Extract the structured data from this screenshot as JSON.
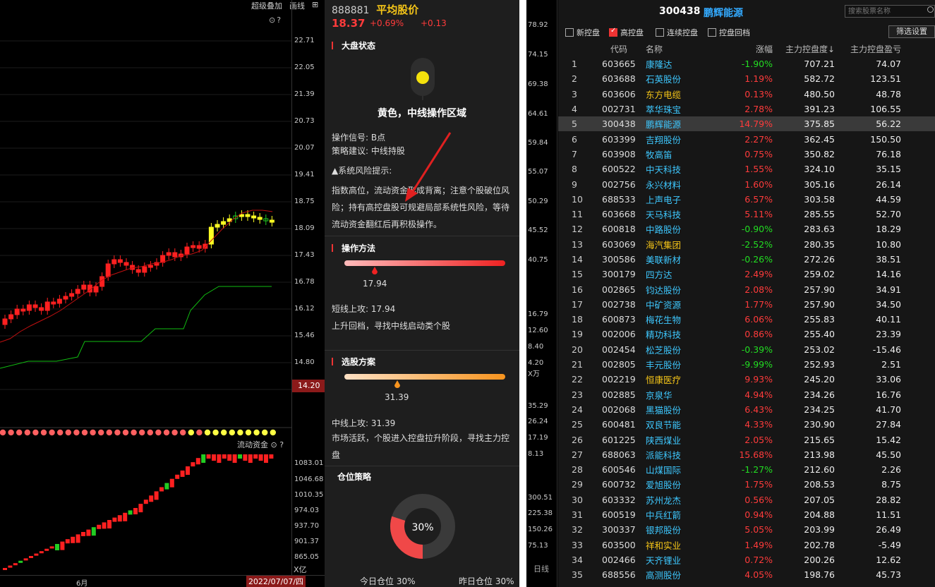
{
  "left_panel": {
    "toolbar": {
      "overlay_label": "超级叠加",
      "draw_label": "画线"
    },
    "price_axis": [
      "22.71",
      "22.05",
      "21.39",
      "20.73",
      "20.07",
      "19.41",
      "18.75",
      "18.09",
      "17.43",
      "16.78",
      "16.12",
      "15.46",
      "14.80"
    ],
    "current_price_label": "14.20",
    "fund_label": "流动资金",
    "fund_axis": [
      "1083.01",
      "1046.68",
      "1010.35",
      "974.03",
      "937.70",
      "901.37",
      "865.05"
    ],
    "fund_unit": "X亿",
    "month_label": "6月",
    "date_label": "2022/07/07/四"
  },
  "info_panel": {
    "code": "888881",
    "name": "平均股价",
    "price": "18.37",
    "change_pct": "+0.69%",
    "change": "+0.13",
    "market_state_title": "大盘状态",
    "light_color": "#f5e20c",
    "state_text": "黄色，中线操作区域",
    "signal": "操作信号: B点",
    "advice": "策略建议: 中线持股",
    "risk_title": "▲系统风险提示:",
    "risk_text": "指数高位，流动资金形成背离；注意个股破位风险；持有高控盘股可规避局部系统性风险，等待流动资金翻红后再积极操作。",
    "method_title": "操作方法",
    "method_value": "17.94",
    "method_line1": "短线上攻: 17.94",
    "method_line2": "上升回档，寻找中线启动类个股",
    "pick_title": "选股方案",
    "pick_value": "31.39",
    "pick_line1": "中线上攻: 31.39",
    "pick_text": "市场活跃，个股进入控盘拉升阶段，寻找主力控盘",
    "position_title": "仓位策略",
    "position_pct_label": "30%",
    "position_fraction": 0.3,
    "today_pos": "今日仓位  30%",
    "yesterday_pos": "昨日仓位  30%"
  },
  "list_panel": {
    "axis_labels": [
      "78.92",
      "74.15",
      "69.38",
      "64.61",
      "59.84",
      "55.07",
      "50.29",
      "45.52",
      "40.75",
      "16.79",
      "12.60",
      "8.40",
      "4.20",
      "X万",
      "35.29",
      "26.24",
      "17.19",
      "8.13",
      "300.51",
      "225.38",
      "150.26",
      "75.13"
    ],
    "kline_label": "日线",
    "title_code": "300438",
    "title_name": "鹏辉能源",
    "search_placeholder": "搜索股票名称",
    "filters": [
      {
        "label": "新控盘",
        "checked": false
      },
      {
        "label": "高控盘",
        "checked": true
      },
      {
        "label": "连续控盘",
        "checked": false
      },
      {
        "label": "控盘回档",
        "checked": false
      }
    ],
    "filter_settings": "筛选设置",
    "columns": [
      "代码",
      "名称",
      "涨幅",
      "主力控盘度↓",
      "主力控盘盈亏"
    ],
    "rows": [
      {
        "n": "1",
        "code": "603665",
        "name": "康隆达",
        "chg": "-1.90%",
        "ctrl": "707.21",
        "pl": "74.07",
        "color": "cyan"
      },
      {
        "n": "2",
        "code": "603688",
        "name": "石英股份",
        "chg": "1.19%",
        "ctrl": "582.72",
        "pl": "123.51",
        "color": "cyan"
      },
      {
        "n": "3",
        "code": "603606",
        "name": "东方电缆",
        "chg": "0.13%",
        "ctrl": "480.50",
        "pl": "48.78",
        "color": "yellow"
      },
      {
        "n": "4",
        "code": "002731",
        "name": "萃华珠宝",
        "chg": "2.78%",
        "ctrl": "391.23",
        "pl": "106.55",
        "color": "cyan"
      },
      {
        "n": "5",
        "code": "300438",
        "name": "鹏辉能源",
        "chg": "14.79%",
        "ctrl": "375.85",
        "pl": "56.22",
        "color": "cyan",
        "selected": true
      },
      {
        "n": "6",
        "code": "603399",
        "name": "吉翔股份",
        "chg": "2.27%",
        "ctrl": "362.45",
        "pl": "150.50",
        "color": "cyan"
      },
      {
        "n": "7",
        "code": "603908",
        "name": "牧高笛",
        "chg": "0.75%",
        "ctrl": "350.82",
        "pl": "76.18",
        "color": "cyan"
      },
      {
        "n": "8",
        "code": "600522",
        "name": "中天科技",
        "chg": "1.55%",
        "ctrl": "324.10",
        "pl": "35.15",
        "color": "cyan"
      },
      {
        "n": "9",
        "code": "002756",
        "name": "永兴材料",
        "chg": "1.60%",
        "ctrl": "305.16",
        "pl": "26.14",
        "color": "cyan"
      },
      {
        "n": "10",
        "code": "688533",
        "name": "上声电子",
        "chg": "6.57%",
        "ctrl": "303.58",
        "pl": "44.59",
        "color": "cyan"
      },
      {
        "n": "11",
        "code": "603668",
        "name": "天马科技",
        "chg": "5.11%",
        "ctrl": "285.55",
        "pl": "52.70",
        "color": "cyan"
      },
      {
        "n": "12",
        "code": "600818",
        "name": "中路股份",
        "chg": "-0.90%",
        "ctrl": "283.63",
        "pl": "18.29",
        "color": "cyan"
      },
      {
        "n": "13",
        "code": "603069",
        "name": "海汽集团",
        "chg": "-2.52%",
        "ctrl": "280.35",
        "pl": "10.80",
        "color": "yellow"
      },
      {
        "n": "14",
        "code": "300586",
        "name": "美联新材",
        "chg": "-0.26%",
        "ctrl": "272.26",
        "pl": "38.51",
        "color": "cyan"
      },
      {
        "n": "15",
        "code": "300179",
        "name": "四方达",
        "chg": "2.49%",
        "ctrl": "259.02",
        "pl": "14.16",
        "color": "cyan"
      },
      {
        "n": "16",
        "code": "002865",
        "name": "钧达股份",
        "chg": "2.08%",
        "ctrl": "257.90",
        "pl": "34.91",
        "color": "cyan"
      },
      {
        "n": "17",
        "code": "002738",
        "name": "中矿资源",
        "chg": "1.77%",
        "ctrl": "257.90",
        "pl": "34.50",
        "color": "cyan"
      },
      {
        "n": "18",
        "code": "600873",
        "name": "梅花生物",
        "chg": "6.06%",
        "ctrl": "255.83",
        "pl": "40.11",
        "color": "cyan"
      },
      {
        "n": "19",
        "code": "002006",
        "name": "精功科技",
        "chg": "0.86%",
        "ctrl": "255.40",
        "pl": "23.39",
        "color": "cyan"
      },
      {
        "n": "20",
        "code": "002454",
        "name": "松芝股份",
        "chg": "-0.39%",
        "ctrl": "253.02",
        "pl": "-15.46",
        "color": "cyan"
      },
      {
        "n": "21",
        "code": "002805",
        "name": "丰元股份",
        "chg": "-9.99%",
        "ctrl": "252.93",
        "pl": "2.51",
        "color": "cyan"
      },
      {
        "n": "22",
        "code": "002219",
        "name": "恒康医疗",
        "chg": "9.93%",
        "ctrl": "245.20",
        "pl": "33.06",
        "color": "yellow"
      },
      {
        "n": "23",
        "code": "002885",
        "name": "京泉华",
        "chg": "4.94%",
        "ctrl": "234.26",
        "pl": "16.76",
        "color": "cyan"
      },
      {
        "n": "24",
        "code": "002068",
        "name": "黑猫股份",
        "chg": "6.43%",
        "ctrl": "234.25",
        "pl": "41.70",
        "color": "cyan"
      },
      {
        "n": "25",
        "code": "600481",
        "name": "双良节能",
        "chg": "4.33%",
        "ctrl": "230.90",
        "pl": "27.84",
        "color": "cyan"
      },
      {
        "n": "26",
        "code": "601225",
        "name": "陕西煤业",
        "chg": "2.05%",
        "ctrl": "215.65",
        "pl": "15.42",
        "color": "cyan"
      },
      {
        "n": "27",
        "code": "688063",
        "name": "派能科技",
        "chg": "15.68%",
        "ctrl": "213.98",
        "pl": "45.50",
        "color": "cyan"
      },
      {
        "n": "28",
        "code": "600546",
        "name": "山煤国际",
        "chg": "-1.27%",
        "ctrl": "212.60",
        "pl": "2.26",
        "color": "cyan"
      },
      {
        "n": "29",
        "code": "600732",
        "name": "爱旭股份",
        "chg": "1.75%",
        "ctrl": "208.53",
        "pl": "8.75",
        "color": "cyan"
      },
      {
        "n": "30",
        "code": "603332",
        "name": "苏州龙杰",
        "chg": "0.56%",
        "ctrl": "207.05",
        "pl": "28.82",
        "color": "cyan"
      },
      {
        "n": "31",
        "code": "600519",
        "name": "中兵红箭",
        "chg": "0.94%",
        "ctrl": "204.88",
        "pl": "11.51",
        "color": "cyan"
      },
      {
        "n": "32",
        "code": "300337",
        "name": "银邦股份",
        "chg": "5.05%",
        "ctrl": "203.99",
        "pl": "26.49",
        "color": "cyan"
      },
      {
        "n": "33",
        "code": "603500",
        "name": "祥和实业",
        "chg": "1.49%",
        "ctrl": "202.78",
        "pl": "-5.49",
        "color": "yellow"
      },
      {
        "n": "34",
        "code": "002466",
        "name": "天齐锂业",
        "chg": "0.72%",
        "ctrl": "200.26",
        "pl": "12.62",
        "color": "cyan"
      },
      {
        "n": "35",
        "code": "688556",
        "name": "高测股份",
        "chg": "4.05%",
        "ctrl": "198.76",
        "pl": "45.73",
        "color": "cyan"
      }
    ]
  }
}
